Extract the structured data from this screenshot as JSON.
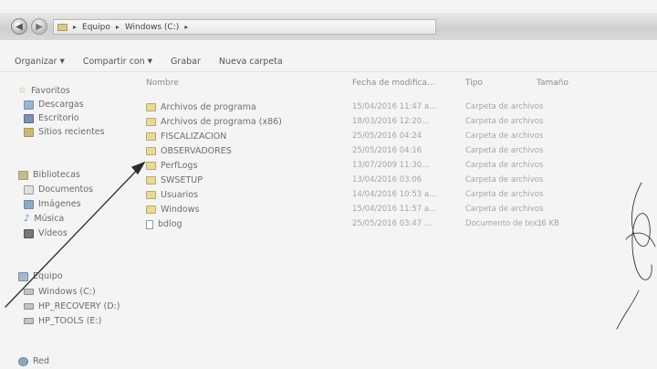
{
  "address": {
    "crumbs": [
      "Equipo",
      "Windows (C:)"
    ]
  },
  "toolbar": {
    "organize_label": "Organizar",
    "share_label": "Compartir con",
    "burn_label": "Grabar",
    "new_folder_label": "Nueva carpeta"
  },
  "nav": {
    "favorites": "Favoritos",
    "downloads": "Descargas",
    "desktop": "Escritorio",
    "recent": "Sitios recientes",
    "libraries": "Bibliotecas",
    "documents": "Documentos",
    "images": "Imágenes",
    "music": "Música",
    "videos": "Vídeos",
    "computer": "Equipo",
    "drive_c": "Windows (C:)",
    "drive_d": "HP_RECOVERY (D:)",
    "drive_e": "HP_TOOLS (E:)",
    "network": "Red"
  },
  "columns": {
    "name": "Nombre",
    "date": "Fecha de modifica...",
    "type": "Tipo",
    "size": "Tamaño"
  },
  "files": [
    {
      "name": "Archivos de programa",
      "date": "15/04/2016 11:47 a...",
      "type": "Carpeta de archivos",
      "size": ""
    },
    {
      "name": "Archivos de programa (x86)",
      "date": "18/03/2016 12:20...",
      "type": "Carpeta de archivos",
      "size": ""
    },
    {
      "name": "FISCALIZACION",
      "date": "25/05/2016 04:24",
      "type": "Carpeta de archivos",
      "size": ""
    },
    {
      "name": "OBSERVADORES",
      "date": "25/05/2016 04:16",
      "type": "Carpeta de archivos",
      "size": ""
    },
    {
      "name": "PerfLogs",
      "date": "13/07/2009 11:30...",
      "type": "Carpeta de archivos",
      "size": ""
    },
    {
      "name": "SWSETUP",
      "date": "13/04/2016 03:06",
      "type": "Carpeta de archivos",
      "size": ""
    },
    {
      "name": "Usuarios",
      "date": "14/04/2016 10:53 a...",
      "type": "Carpeta de archivos",
      "size": ""
    },
    {
      "name": "Windows",
      "date": "15/04/2016 11:57 a...",
      "type": "Carpeta de archivos",
      "size": ""
    },
    {
      "name": "bdlog",
      "date": "25/05/2016 03:47 ...",
      "type": "Documento de tex...",
      "size": "36 KB"
    }
  ],
  "colors": {
    "background": "#f4f4f4",
    "addressbar": "#d4d4d4",
    "annotation": "#2b2b2b"
  }
}
